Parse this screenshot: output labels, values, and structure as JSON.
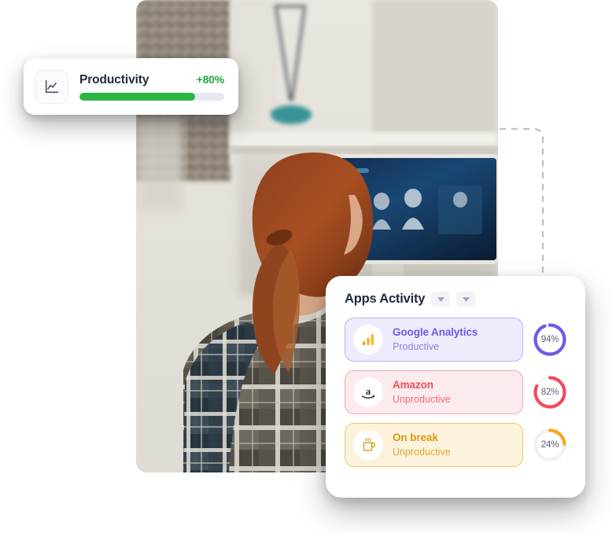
{
  "productivity_card": {
    "icon": "line-chart-icon",
    "title": "Productivity",
    "percent_label": "+80%",
    "progress_value": 80,
    "progress_color": "#2cb742",
    "track_color": "#e6e9f0",
    "percent_color": "#23a73f"
  },
  "apps_activity_card": {
    "title": "Apps Activity",
    "dropdowns": [
      {
        "name": "filter-dropdown-1",
        "icon": "chevron-down-icon"
      },
      {
        "name": "filter-dropdown-2",
        "icon": "chevron-down-icon"
      }
    ],
    "rows": [
      {
        "name": "Google Analytics",
        "status": "Productive",
        "percent": 94,
        "percent_label": "94%",
        "icon": "google-analytics-icon",
        "accent": "#6c5ce7",
        "name_color": "#6c5ce7",
        "status_color": "#8b85dd",
        "bg": "#eeecfc",
        "border": "#b9b2f2",
        "ring_color": "#6c5ce7",
        "ring_track": "#eceefb"
      },
      {
        "name": "Amazon",
        "status": "Unproductive",
        "percent": 82,
        "percent_label": "82%",
        "icon": "amazon-icon",
        "accent": "#ef4b5a",
        "name_color": "#ef4b5a",
        "status_color": "#ef6b78",
        "bg": "#fcebec",
        "border": "#f3a8b0",
        "ring_color": "#ef4b5a",
        "ring_track": "#f4f5fa"
      },
      {
        "name": "On break",
        "status": "Unproductive",
        "percent": 24,
        "percent_label": "24%",
        "icon": "coffee-cup-icon",
        "accent": "#e2a214",
        "name_color": "#d79a12",
        "status_color": "#dfa72b",
        "ring_color": "#f5a623",
        "bg": "#fdf3dd",
        "border": "#f2c65c",
        "ring_track": "#eef1f7"
      }
    ]
  },
  "photo": {
    "alt": "woman-at-desk-photo",
    "description": "Woman with red hair in plaid shirt working at a desktop monitor"
  },
  "connector": {
    "name": "dashed-connector-line",
    "color": "#b9bfcc",
    "style": "dashed"
  }
}
